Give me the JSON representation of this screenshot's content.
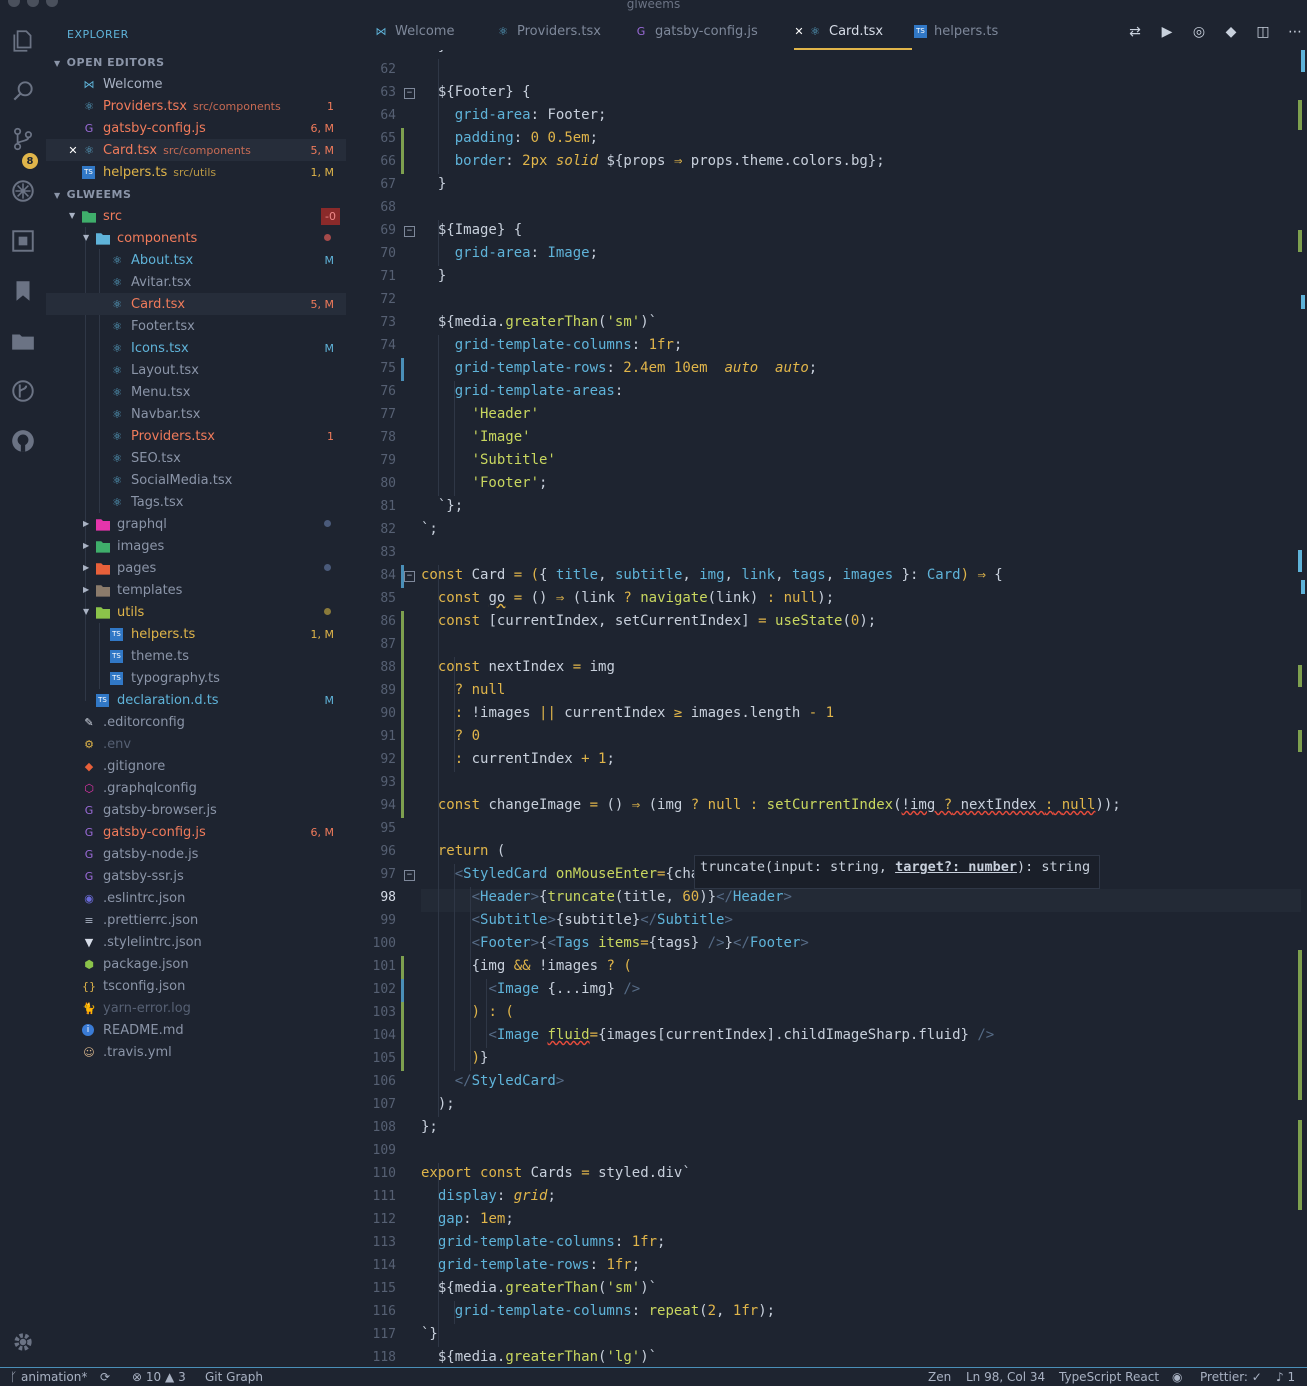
{
  "window": {
    "title": "glweems"
  },
  "activity": {
    "scm_badge": "8"
  },
  "explorer": {
    "title": "EXPLORER",
    "open_editors_label": "OPEN EDITORS",
    "project_label": "GLWEEMS",
    "open_editors": [
      {
        "name": "Welcome",
        "desc": "",
        "deco": "",
        "color": "#a9b2c3",
        "icon": "vscode-icon"
      },
      {
        "name": "Providers.tsx",
        "desc": "src/components",
        "deco": "1",
        "color": "#f07b5b",
        "icon": "react-icon"
      },
      {
        "name": "gatsby-config.js",
        "desc": "",
        "deco": "6, M",
        "color": "#f07b5b",
        "icon": "gatsby-icon"
      },
      {
        "name": "Card.tsx",
        "desc": "src/components",
        "deco": "5, M",
        "color": "#f07b5b",
        "icon": "react-icon"
      },
      {
        "name": "helpers.ts",
        "desc": "src/utils",
        "deco": "1, M",
        "color": "#e0b54a",
        "icon": "ts-icon"
      }
    ],
    "tree": [
      {
        "name": "src",
        "level": 1,
        "type": "folder",
        "open": true,
        "deco": "-0",
        "color": "#f07b5b"
      },
      {
        "name": "components",
        "level": 2,
        "type": "folder",
        "open": true,
        "deco": "dot-red",
        "color": "#f07b5b"
      },
      {
        "name": "About.tsx",
        "level": 3,
        "deco": "M",
        "color": "#5fb3d9"
      },
      {
        "name": "Avitar.tsx",
        "level": 3,
        "deco": "",
        "color": "#8b95a8"
      },
      {
        "name": "Card.tsx",
        "level": 3,
        "deco": "5, M",
        "color": "#f07b5b"
      },
      {
        "name": "Footer.tsx",
        "level": 3,
        "deco": "",
        "color": "#8b95a8"
      },
      {
        "name": "Icons.tsx",
        "level": 3,
        "deco": "M",
        "color": "#5fb3d9"
      },
      {
        "name": "Layout.tsx",
        "level": 3,
        "deco": "",
        "color": "#8b95a8"
      },
      {
        "name": "Menu.tsx",
        "level": 3,
        "deco": "",
        "color": "#8b95a8"
      },
      {
        "name": "Navbar.tsx",
        "level": 3,
        "deco": "",
        "color": "#8b95a8"
      },
      {
        "name": "Providers.tsx",
        "level": 3,
        "deco": "1",
        "color": "#f07b5b"
      },
      {
        "name": "SEO.tsx",
        "level": 3,
        "deco": "",
        "color": "#8b95a8"
      },
      {
        "name": "SocialMedia.tsx",
        "level": 3,
        "deco": "",
        "color": "#8b95a8"
      },
      {
        "name": "Tags.tsx",
        "level": 3,
        "deco": "",
        "color": "#8b95a8"
      },
      {
        "name": "graphql",
        "level": 2,
        "type": "folder",
        "open": false,
        "deco": "dot-blue",
        "color": "#8b95a8"
      },
      {
        "name": "images",
        "level": 2,
        "type": "folder",
        "open": false,
        "deco": "",
        "color": "#8b95a8"
      },
      {
        "name": "pages",
        "level": 2,
        "type": "folder",
        "open": false,
        "deco": "dot-blue",
        "color": "#8b95a8"
      },
      {
        "name": "templates",
        "level": 2,
        "type": "folder",
        "open": false,
        "deco": "",
        "color": "#8b95a8"
      },
      {
        "name": "utils",
        "level": 2,
        "type": "folder",
        "open": true,
        "deco": "dot-yellow",
        "color": "#e0b54a"
      },
      {
        "name": "helpers.ts",
        "level": 3,
        "deco": "1, M",
        "color": "#e0b54a"
      },
      {
        "name": "theme.ts",
        "level": 3,
        "deco": "",
        "color": "#8b95a8"
      },
      {
        "name": "typography.ts",
        "level": 3,
        "deco": "",
        "color": "#8b95a8"
      },
      {
        "name": "declaration.d.ts",
        "level": 2,
        "deco": "M",
        "color": "#5fb3d9"
      },
      {
        "name": ".editorconfig",
        "level": 1,
        "deco": "",
        "color": "#8b95a8"
      },
      {
        "name": ".env",
        "level": 1,
        "deco": "",
        "color": "#566073"
      },
      {
        "name": ".gitignore",
        "level": 1,
        "deco": "",
        "color": "#8b95a8"
      },
      {
        "name": ".graphqlconfig",
        "level": 1,
        "deco": "",
        "color": "#8b95a8"
      },
      {
        "name": "gatsby-browser.js",
        "level": 1,
        "deco": "",
        "color": "#8b95a8"
      },
      {
        "name": "gatsby-config.js",
        "level": 1,
        "deco": "6, M",
        "color": "#f07b5b"
      },
      {
        "name": "gatsby-node.js",
        "level": 1,
        "deco": "",
        "color": "#8b95a8"
      },
      {
        "name": "gatsby-ssr.js",
        "level": 1,
        "deco": "",
        "color": "#8b95a8"
      },
      {
        "name": ".eslintrc.json",
        "level": 1,
        "deco": "",
        "color": "#8b95a8"
      },
      {
        "name": ".prettierrc.json",
        "level": 1,
        "deco": "",
        "color": "#8b95a8"
      },
      {
        "name": ".stylelintrc.json",
        "level": 1,
        "deco": "",
        "color": "#8b95a8"
      },
      {
        "name": "package.json",
        "level": 1,
        "deco": "",
        "color": "#8b95a8"
      },
      {
        "name": "tsconfig.json",
        "level": 1,
        "deco": "",
        "color": "#8b95a8"
      },
      {
        "name": "yarn-error.log",
        "level": 1,
        "deco": "",
        "color": "#566073"
      },
      {
        "name": "README.md",
        "level": 1,
        "deco": "",
        "color": "#8b95a8"
      },
      {
        "name": ".travis.yml",
        "level": 1,
        "deco": "",
        "color": "#8b95a8"
      }
    ]
  },
  "tabs": [
    {
      "label": "Welcome",
      "icon": "vscode-icon",
      "active": false
    },
    {
      "label": "Providers.tsx",
      "icon": "react-icon",
      "active": false
    },
    {
      "label": "gatsby-config.js",
      "icon": "gatsby-icon",
      "active": false
    },
    {
      "label": "Card.tsx",
      "icon": "react-icon",
      "active": true
    },
    {
      "label": "helpers.ts",
      "icon": "ts-icon",
      "active": false
    }
  ],
  "editor": {
    "first_line": 61,
    "current_line": 98,
    "hover": {
      "prefix": "truncate(input: string, ",
      "param": "target?: number",
      "suffix": "): string"
    }
  },
  "status": {
    "branch": "animation*",
    "errors": "10",
    "warnings": "3",
    "git_graph": "Git Graph",
    "zen": "Zen",
    "position": "Ln 98, Col 34",
    "language": "TypeScript React",
    "prettier": "Prettier: ✓",
    "notifications": "1"
  }
}
